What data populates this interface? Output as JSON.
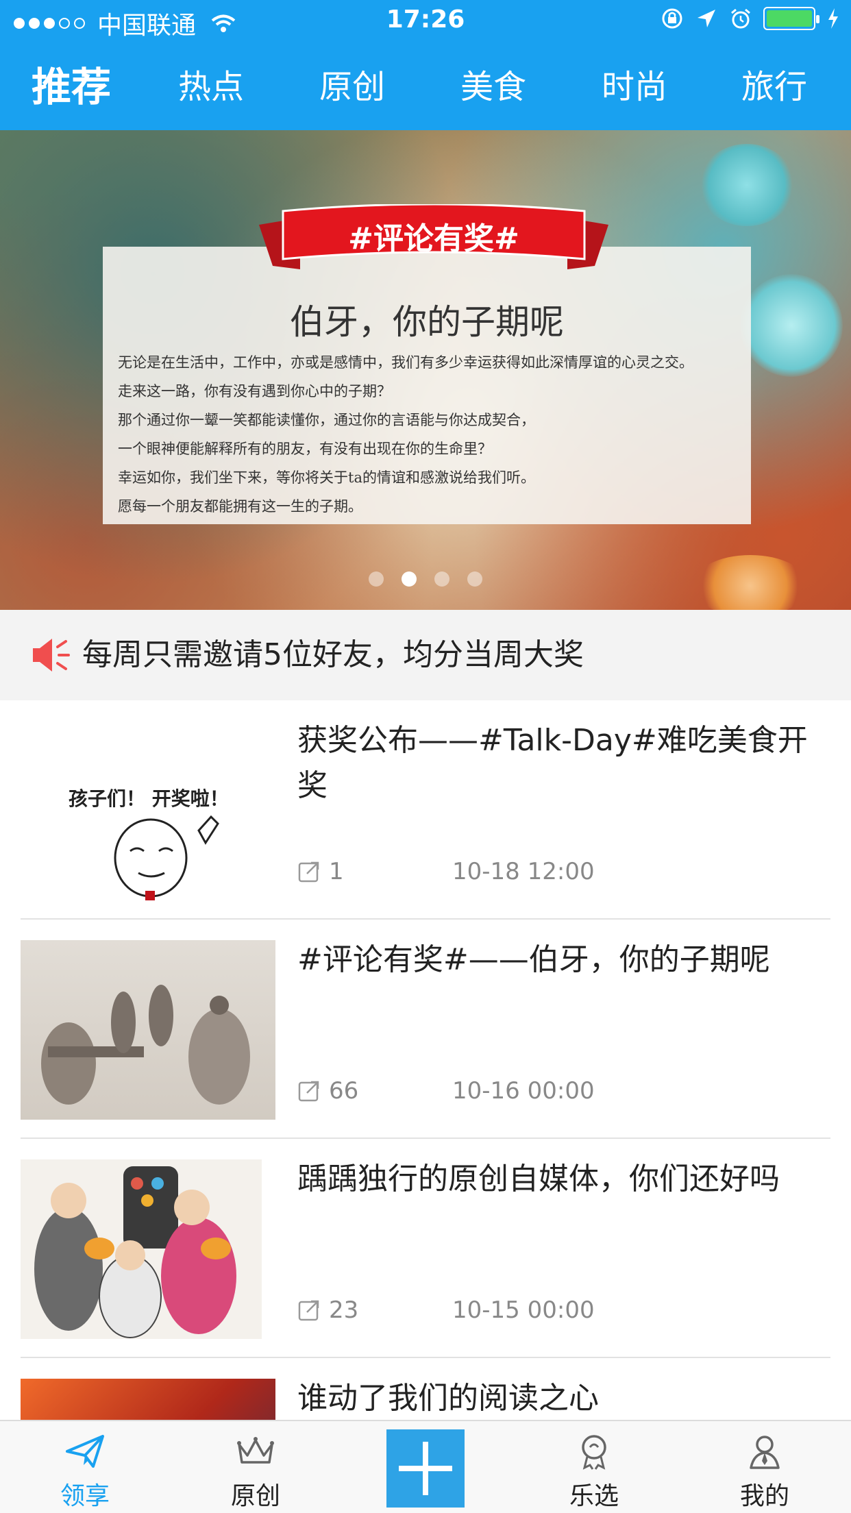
{
  "status_bar": {
    "carrier": "中国联通",
    "time": "17:26"
  },
  "tabs": [
    {
      "label": "推荐",
      "active": true
    },
    {
      "label": "热点",
      "active": false
    },
    {
      "label": "原创",
      "active": false
    },
    {
      "label": "美食",
      "active": false
    },
    {
      "label": "时尚",
      "active": false
    },
    {
      "label": "旅行",
      "active": false
    }
  ],
  "banner": {
    "ribbon_text": "#评论有奖#",
    "title": "伯牙，你的子期呢",
    "lines": [
      "无论是在生活中，工作中，亦或是感情中，我们有多少幸运获得如此深情厚谊的心灵之交。",
      "走来这一路，你有没有遇到你心中的子期？",
      "那个通过你一颦一笑都能读懂你，通过你的言语能与你达成契合，",
      "一个眼神便能解释所有的朋友，有没有出现在你的生命里？",
      "幸运如你，我们坐下来，等你将关于ta的情谊和感激说给我们听。",
      "愿每一个朋友都能拥有这一生的子期。"
    ],
    "page_index": 1,
    "page_count": 4
  },
  "notice": {
    "text": "每周只需邀请5位好友，均分当周大奖"
  },
  "articles": [
    {
      "title": "获奖公布——#Talk-Day#难吃美食开奖",
      "count": "1",
      "date": "10-18 12:00",
      "thumb_text": "孩子们！ 开奖啦！"
    },
    {
      "title": "#评论有奖#——伯牙，你的子期呢",
      "count": "66",
      "date": "10-16 00:00"
    },
    {
      "title": "踽踽独行的原创自媒体，你们还好吗",
      "count": "23",
      "date": "10-15 00:00"
    },
    {
      "title": "谁动了我们的阅读之心",
      "count": "",
      "date": ""
    }
  ],
  "tabbar": [
    {
      "label": "领享",
      "icon": "paper-plane-icon",
      "active": true
    },
    {
      "label": "原创",
      "icon": "crown-icon",
      "active": false
    },
    {
      "label": "",
      "icon": "plus-icon",
      "active": false
    },
    {
      "label": "乐选",
      "icon": "medal-icon",
      "active": false
    },
    {
      "label": "我的",
      "icon": "person-icon",
      "active": false
    }
  ],
  "colors": {
    "brand": "#19a1f0",
    "notice_icon": "#f04e4e",
    "plus_button": "#2ea3e6"
  }
}
